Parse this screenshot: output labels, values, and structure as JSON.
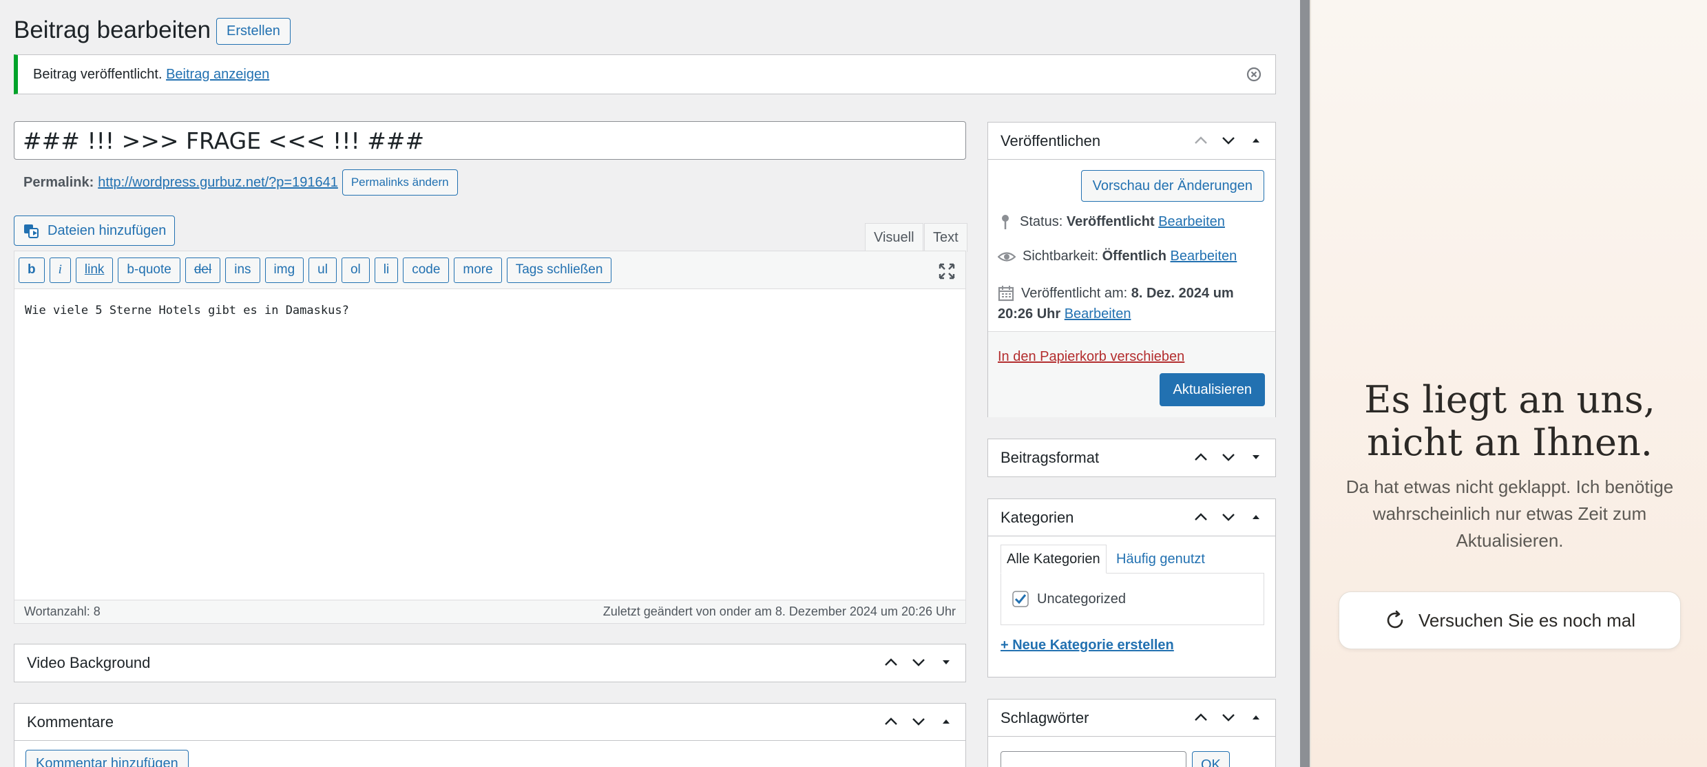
{
  "header": {
    "title": "Beitrag bearbeiten",
    "add_new": "Erstellen"
  },
  "notice": {
    "text": "Beitrag veröffentlicht.",
    "link": "Beitrag anzeigen"
  },
  "post": {
    "title": "### !!! >>> FRAGE <<< !!! ###",
    "permalink_label": "Permalink:",
    "permalink_url": "http://wordpress.gurbuz.net/?p=191641",
    "permalink_button": "Permalinks ändern"
  },
  "editor": {
    "media_button": "Dateien hinzufügen",
    "tab_visual": "Visuell",
    "tab_text": "Text",
    "toolbar": [
      "b",
      "i",
      "link",
      "b-quote",
      "del",
      "ins",
      "img",
      "ul",
      "ol",
      "li",
      "code",
      "more",
      "Tags schließen"
    ],
    "content": "Wie viele 5 Sterne Hotels gibt es in Damaskus?",
    "word_count": "Wortanzahl: 8",
    "last_edited": "Zuletzt geändert von onder am 8. Dezember 2024 um 20:26 Uhr"
  },
  "boxes_main": {
    "video_bg": "Video Background",
    "comments": "Kommentare",
    "add_comment": "Kommentar hinzufügen"
  },
  "publish": {
    "title": "Veröffentlichen",
    "preview": "Vorschau der Änderungen",
    "status_label": "Status:",
    "status_value": "Veröffentlicht",
    "visibility_label": "Sichtbarkeit:",
    "visibility_value": "Öffentlich",
    "published_label": "Veröffentlicht am:",
    "published_value_1": "8. Dez. 2024 um",
    "published_value_2": "20:26 Uhr",
    "edit": "Bearbeiten",
    "trash": "In den Papierkorb verschieben",
    "update": "Aktualisieren"
  },
  "format": {
    "title": "Beitragsformat"
  },
  "categories": {
    "title": "Kategorien",
    "tab_all": "Alle Kategorien",
    "tab_popular": "Häufig genutzt",
    "item": "Uncategorized",
    "add_new": "+ Neue Kategorie erstellen"
  },
  "tags": {
    "title": "Schlagwörter",
    "add": "OK"
  },
  "side_panel": {
    "title_1": "Es liegt an uns,",
    "title_2": "nicht an Ihnen.",
    "message": "Da hat etwas nicht geklappt. Ich benötige wahrscheinlich nur etwas Zeit zum Aktualisieren.",
    "retry": "Versuchen Sie es noch mal"
  },
  "colors": {
    "primary": "#2271b1",
    "success": "#00a32a",
    "trash": "#b32d2e"
  }
}
